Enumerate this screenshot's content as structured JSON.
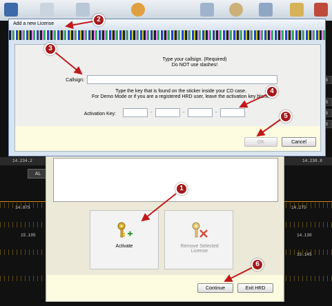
{
  "dialog": {
    "title": "Add a new License",
    "instruction_line1": "Type your callsign. (Required)",
    "instruction_line2": "Do NOT use slashes!",
    "callsign_label": "Callsign:",
    "callsign_value": "",
    "key_instruction_line1": "Type the key that is found on the sticker inside your CD case.",
    "key_instruction_line2": "For Demo Mode or if you are a registered HRD user, leave the activation key blank.",
    "activation_key_label": "Activation Key:",
    "activation_key_segments": [
      "",
      "",
      "",
      ""
    ],
    "segment_separator": "-",
    "ok_label": "OK",
    "cancel_label": "Cancel"
  },
  "license_manager": {
    "activate_label": "Activate",
    "remove_label": "Remove Selected License",
    "continue_label": "Continue",
    "exit_label": "Exit HRD"
  },
  "background": {
    "freq_left_top": "14.234.2",
    "freq_right_top": "14.238.8",
    "freq_left_2": "14.075",
    "freq_right_2": "14.275",
    "freq_right_3": "14.130",
    "freq_left_3": "15.105",
    "freq_right_4": "15.145",
    "al_button": "AL",
    "side_tabs": [
      "B",
      "B",
      "B",
      "B"
    ]
  },
  "annotations": [
    "1",
    "2",
    "3",
    "4",
    "5",
    "6"
  ],
  "colors": {
    "marker": "#a6191b",
    "dialog_border": "#6a86b0",
    "footer_bg": "#fdfbe0"
  }
}
